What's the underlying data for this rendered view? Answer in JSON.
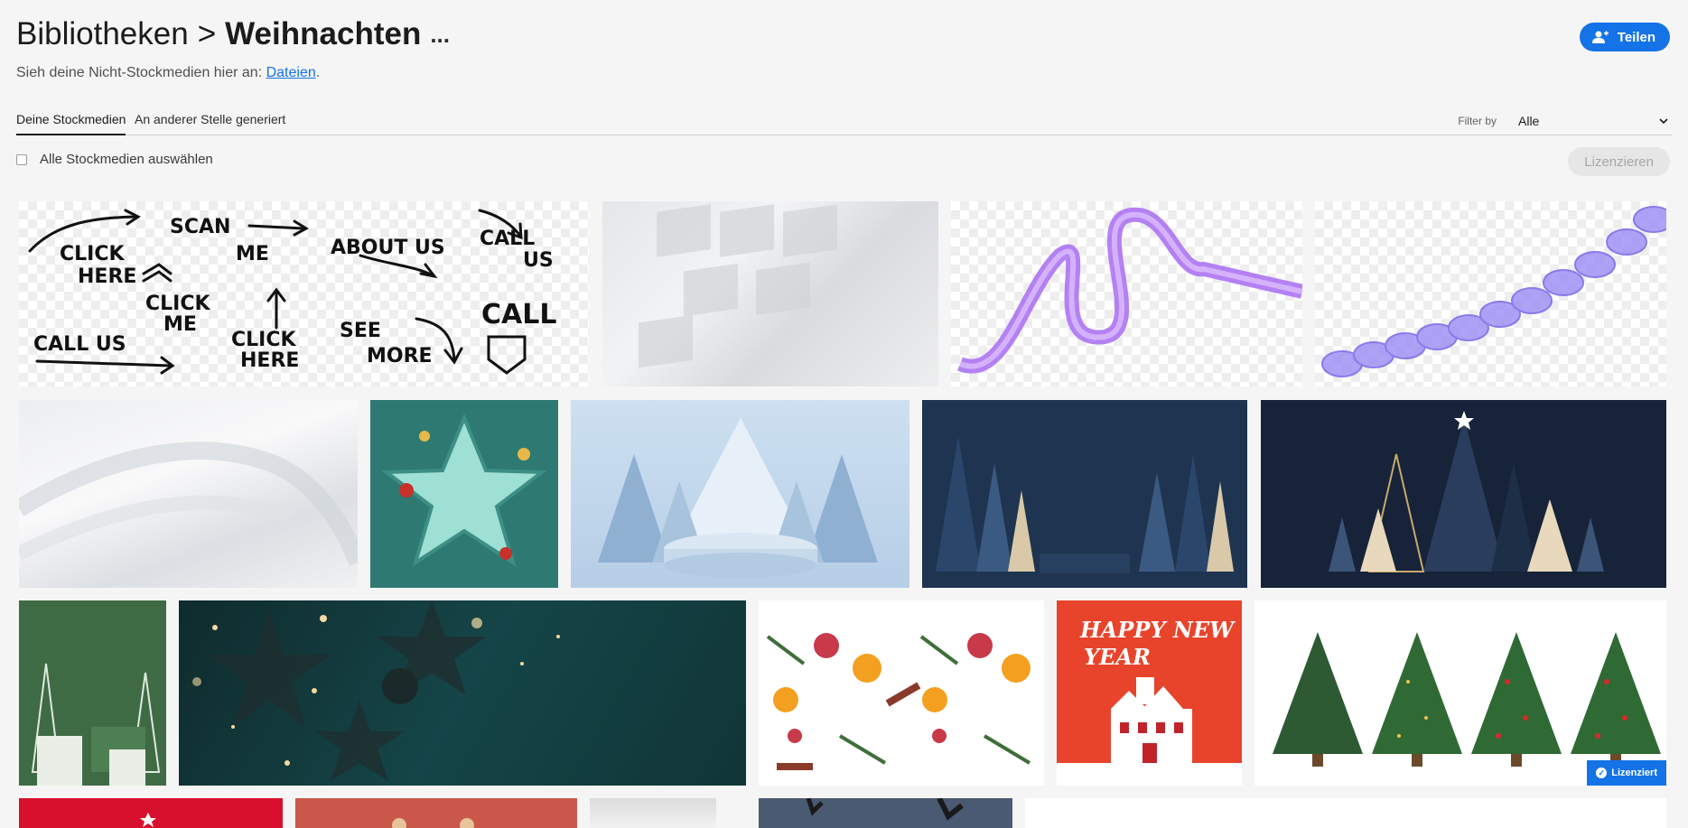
{
  "header": {
    "library": "Bibliotheken",
    "separator": ">",
    "current": "Weihnachten",
    "more": "...",
    "share_label": "Teilen"
  },
  "subline": {
    "text": "Sieh deine Nicht-Stockmedien hier an: ",
    "link": "Dateien",
    "suffix": "."
  },
  "tabs": [
    {
      "label": "Deine Stockmedien",
      "active": true
    },
    {
      "label": "An anderer Stelle generiert",
      "active": false
    }
  ],
  "filter": {
    "label": "Filter by",
    "value": "Alle"
  },
  "select_all_label": "Alle Stockmedien auswählen",
  "license_button": "Lizenzieren",
  "licensed_badge": "Lizenziert",
  "arrows_sheet": {
    "texts": [
      "CLICK HERE",
      "SCAN ME",
      "ABOUT US",
      "CALL US",
      "CLICK ME",
      "CALL US",
      "CLICK HERE",
      "SEE MORE",
      "CALL"
    ]
  },
  "new_year_card": {
    "line1": "HAPPY NEW",
    "line2": "YEAR"
  },
  "colors": {
    "accent": "#1473e6",
    "red_card": "#e8442c"
  }
}
